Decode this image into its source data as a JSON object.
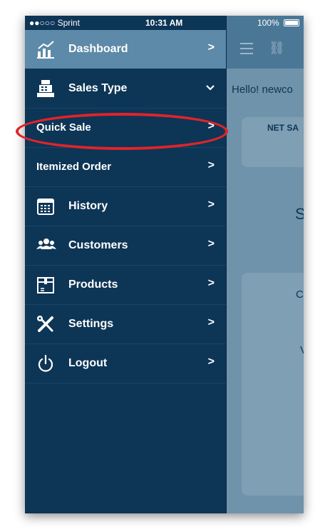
{
  "status_bar": {
    "carrier": "●●○○○ Sprint",
    "time": "10:31 AM",
    "battery": "100%"
  },
  "menu": {
    "items": [
      {
        "label": "Dashboard",
        "chevron": ">",
        "icon": "dashboard-icon"
      },
      {
        "label": "Sales Type",
        "chevron": "v",
        "icon": "cash-register-icon"
      },
      {
        "label": "Quick Sale",
        "chevron": ">"
      },
      {
        "label": "Itemized Order",
        "chevron": ">"
      },
      {
        "label": "History",
        "chevron": ">",
        "icon": "calendar-icon"
      },
      {
        "label": "Customers",
        "chevron": ">",
        "icon": "customers-icon"
      },
      {
        "label": "Products",
        "chevron": ">",
        "icon": "box-icon"
      },
      {
        "label": "Settings",
        "chevron": ">",
        "icon": "tools-icon"
      },
      {
        "label": "Logout",
        "chevron": ">",
        "icon": "power-icon"
      }
    ]
  },
  "background_screen": {
    "greeting": "Hello! newco",
    "card_title": "NET SA",
    "letter_s": "S",
    "letter_c": "C",
    "letter_v": "V"
  },
  "colors": {
    "menu_bg": "#0d3556",
    "active_row": "#5d8aa8",
    "highlight": "#e0242a"
  }
}
